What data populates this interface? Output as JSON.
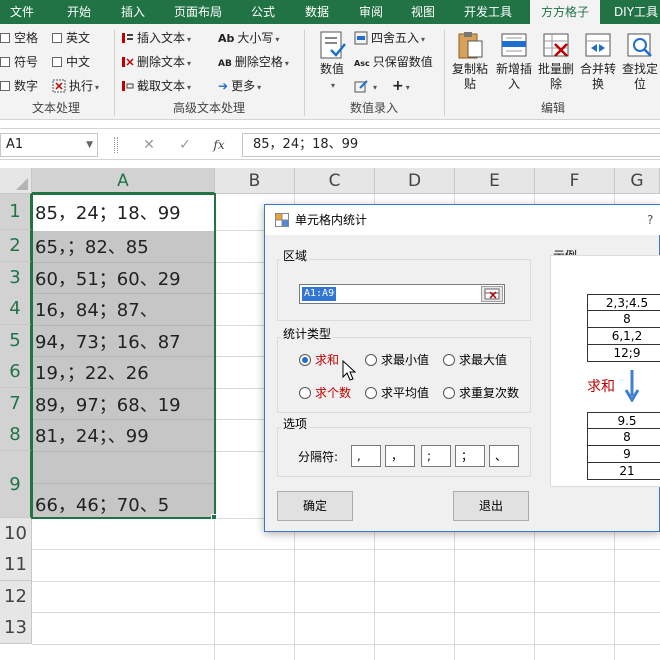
{
  "ribbon_tabs": [
    {
      "label": "文件"
    },
    {
      "label": "开始"
    },
    {
      "label": "插入"
    },
    {
      "label": "页面布局"
    },
    {
      "label": "公式"
    },
    {
      "label": "数据"
    },
    {
      "label": "审阅"
    },
    {
      "label": "视图"
    },
    {
      "label": "开发工具"
    },
    {
      "label": "方方格子",
      "active": true
    },
    {
      "label": "DIY工具"
    }
  ],
  "ribbon": {
    "text_group": {
      "checkboxes": [
        "空格",
        "英文",
        "符号",
        "中文",
        "数字"
      ],
      "execute": "执行",
      "label": "文本处理"
    },
    "advanced_group": {
      "insert_text": "插入文本",
      "delete_text": "删除文本",
      "extract_text": "截取文本",
      "case": "大小写",
      "delete_space": "删除空格",
      "more": "更多",
      "case_icon": "Ab",
      "delete_space_icon": "AB",
      "label": "高级文本处理"
    },
    "number_group": {
      "number": "数值",
      "round": "四舍五入",
      "keep_value": "只保留数值",
      "plus": "+",
      "label": "数值录入"
    },
    "edit_group": {
      "copy_paste": "复制粘贴",
      "add_insert": "新增插入",
      "batch_delete": "批量删除",
      "merge_convert": "合并转换",
      "find_locate": "查找定位",
      "label": "编辑"
    }
  },
  "formula_bar": {
    "name_box": "A1",
    "cancel": "✕",
    "enter": "✓",
    "fx": "fx",
    "content": "85，24；18、99"
  },
  "grid": {
    "columns": [
      "A",
      "B",
      "C",
      "D",
      "E",
      "F",
      "G"
    ],
    "rows": [
      "1",
      "2",
      "3",
      "4",
      "5",
      "6",
      "7",
      "8",
      "9",
      "10",
      "11",
      "12",
      "13"
    ],
    "cells_A": [
      "85，24；18、99",
      "65，；82、85",
      "60，51；60、29",
      "16，84；87、",
      "94，73；16、87",
      "19，；22、26",
      "89，97；68、19",
      "81，24；、99",
      "66，46；70、5"
    ]
  },
  "dialog": {
    "title": "单元格内统计",
    "help": "?",
    "region_label": "区域",
    "range_value": "A1:A9",
    "stat_type_label": "统计类型",
    "options": [
      {
        "label": "求和",
        "selected": true
      },
      {
        "label": "求最小值",
        "selected": false
      },
      {
        "label": "求最大值",
        "selected": false
      },
      {
        "label": "求个数",
        "selected": false
      },
      {
        "label": "求平均值",
        "selected": false
      },
      {
        "label": "求重复次数",
        "selected": false
      }
    ],
    "options_label": "选项",
    "separator_label": "分隔符:",
    "separators": [
      ",",
      "，",
      ";",
      "；",
      "、"
    ],
    "ok": "确定",
    "exit": "退出",
    "example_label": "示例",
    "example_top": [
      "2,3;4.5",
      "8",
      "6,1,2",
      "12;9"
    ],
    "example_sum": "求和",
    "example_bottom": [
      "9.5",
      "8",
      "9",
      "21"
    ]
  },
  "colors": {
    "excel_green": "#217346",
    "selection_grey": "#c6c6c6",
    "dialog_bg": "#f0f0f0",
    "highlight_blue": "#3276d4",
    "red_text": "#c00000"
  }
}
